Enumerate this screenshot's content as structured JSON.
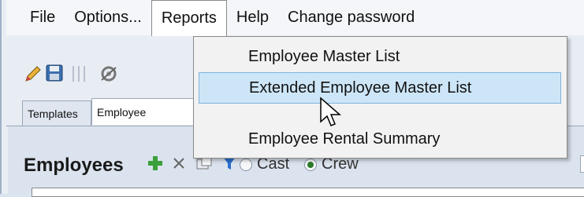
{
  "menubar": {
    "items": [
      {
        "label": "File"
      },
      {
        "label": "Options..."
      },
      {
        "label": "Reports"
      },
      {
        "label": "Help"
      },
      {
        "label": "Change password"
      }
    ]
  },
  "reports_menu": {
    "items": [
      {
        "label": "Employee Master List"
      },
      {
        "label": "Extended Employee Master List"
      },
      {
        "label": "Employee Rental Summary"
      }
    ]
  },
  "toolbar": {
    "icons": [
      "pencil-icon",
      "save-icon",
      "separator-icon",
      "settings-icon"
    ]
  },
  "tabs": [
    {
      "label": "Templates"
    },
    {
      "label": "Employee"
    }
  ],
  "main": {
    "heading": "Employees",
    "filters": [
      {
        "label": "Cast",
        "selected": false
      },
      {
        "label": "Crew",
        "selected": true
      }
    ]
  },
  "colors": {
    "menu_hover_bg": "#cde6f7",
    "menu_hover_border": "#7fb4dc",
    "radio_selected": "#2a7a2a",
    "add_icon": "#3aa03a",
    "filter_icon": "#2b6fcf"
  }
}
